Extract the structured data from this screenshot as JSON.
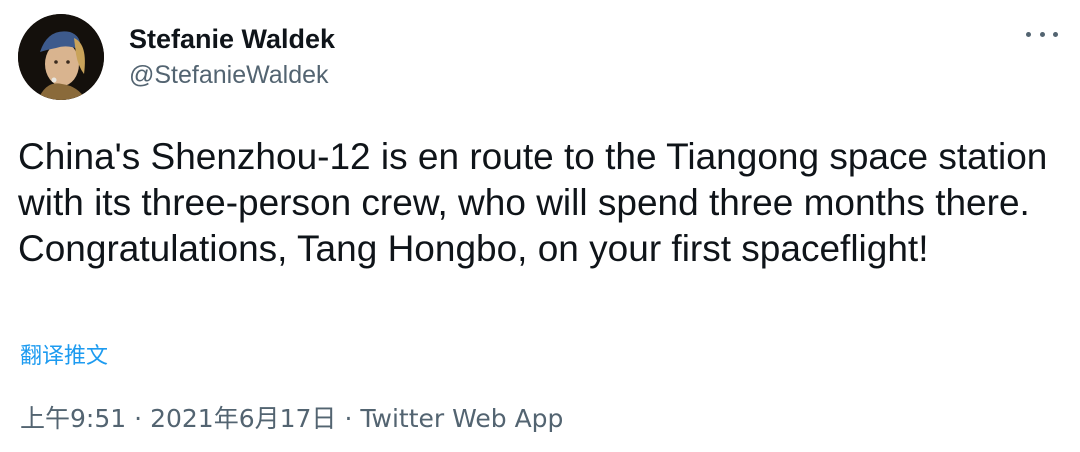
{
  "author": {
    "display_name": "Stefanie Waldek",
    "handle": "@StefanieWaldek"
  },
  "tweet": {
    "text": "China's Shenzhou-12 is en route to the Tiangong space station with its three-person crew, who will spend three months there. Congratulations, Tang Hongbo, on your first spaceflight!",
    "translate_label": "翻译推文"
  },
  "meta": {
    "time": "上午9:51",
    "date": "2021年6月17日",
    "separator": "·",
    "source": "Twitter Web App"
  },
  "icons": {
    "more": "more-horizontal-icon"
  },
  "colors": {
    "text_primary": "#0f1419",
    "text_secondary": "#536471",
    "link": "#1d9bf0"
  }
}
